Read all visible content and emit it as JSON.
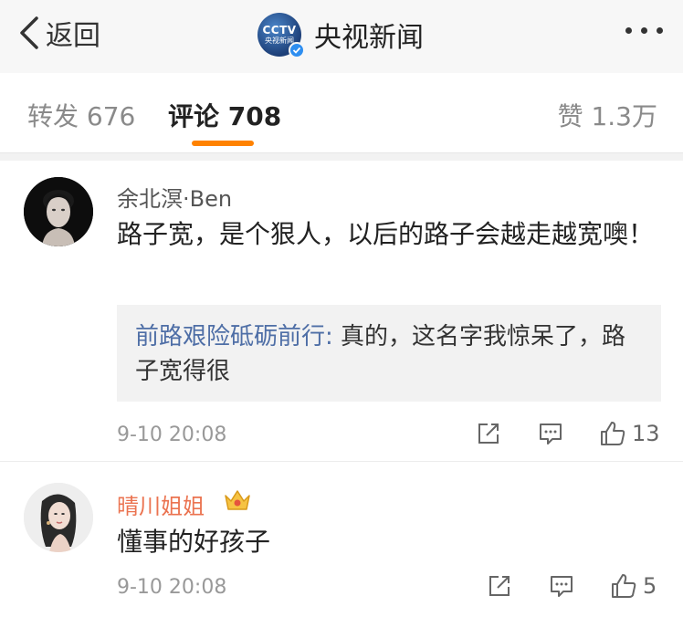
{
  "nav": {
    "back_label": "返回",
    "account_name": "央视新闻",
    "account_logo_text": "CCTV",
    "account_logo_sub": "央视新闻"
  },
  "tabs": {
    "repost": "转发 676",
    "comment": "评论 708",
    "like": "赞 1.3万",
    "active_color": "#ff8200"
  },
  "comments": [
    {
      "user": "余北溟·Ben",
      "text": "路子宽，是个狠人，以后的路子会越走越宽噢！",
      "reply": {
        "user": "前路艰险砥砺前行:",
        "text": " 真的，这名字我惊呆了，路子宽得很"
      },
      "time": "9-10 20:08",
      "likes": "13"
    },
    {
      "user": "晴川姐姐",
      "user_color": "#eb7350",
      "badge": "crown-icon",
      "text": "懂事的好孩子",
      "time": "9-10 20:08",
      "likes": "5"
    }
  ]
}
